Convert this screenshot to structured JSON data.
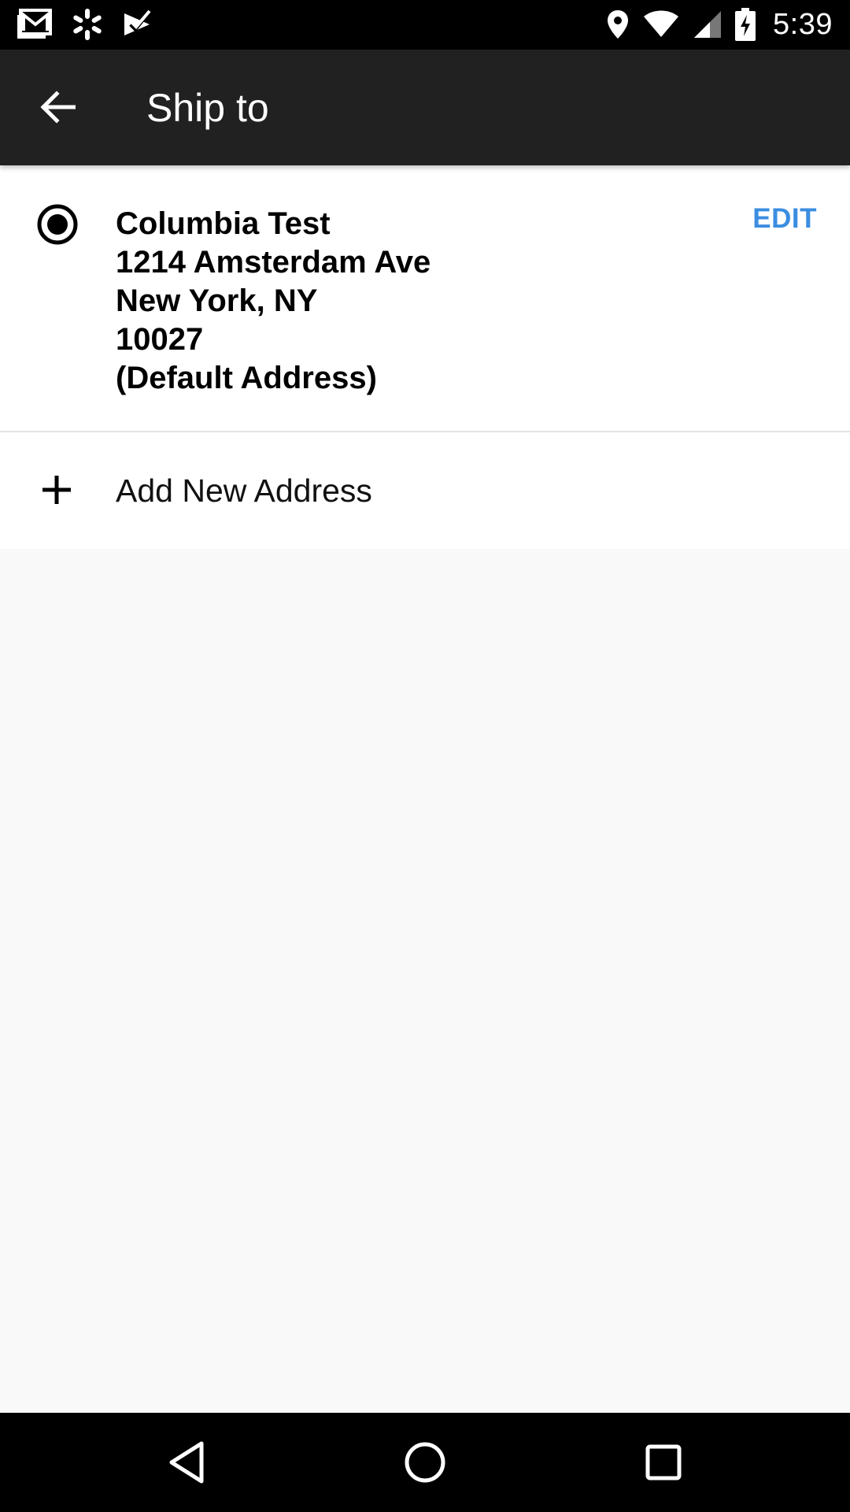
{
  "status_bar": {
    "time": "5:39",
    "left_icons": [
      "gmail-icon",
      "walmart-spark-icon",
      "checkmark-notification-icon"
    ],
    "right_icons": [
      "location-pin-icon",
      "wifi-icon",
      "cell-signal-icon",
      "battery-charging-icon"
    ]
  },
  "app_bar": {
    "title": "Ship to",
    "back_icon": "back-arrow-icon",
    "background": "#212121"
  },
  "address": {
    "selected": true,
    "lines": [
      "Columbia Test",
      "1214 Amsterdam Ave",
      "New York, NY",
      "10027",
      "(Default Address)"
    ],
    "edit_label": "EDIT",
    "accent_color": "#3b8de0"
  },
  "add_address": {
    "icon": "plus-icon",
    "label": "Add New Address"
  },
  "nav_bar": {
    "buttons": [
      "back-triangle-icon",
      "home-circle-icon",
      "recents-square-icon"
    ]
  }
}
